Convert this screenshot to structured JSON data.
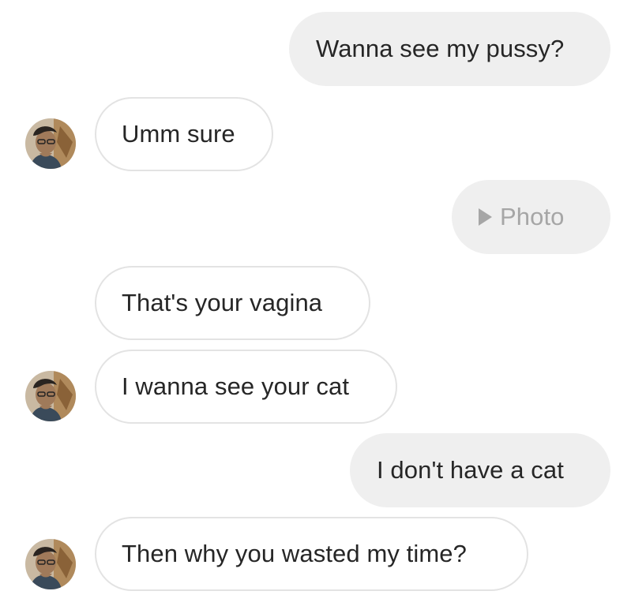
{
  "messages": [
    {
      "direction": "outgoing",
      "text": "Wanna see my pussy?"
    },
    {
      "direction": "incoming",
      "text": "Umm sure",
      "avatar": true
    },
    {
      "direction": "outgoing",
      "type": "photo",
      "text": "Photo",
      "icon": "play-icon"
    },
    {
      "direction": "incoming",
      "text": "That's your vagina",
      "avatar": false
    },
    {
      "direction": "incoming",
      "text": "I wanna see your cat",
      "avatar": true
    },
    {
      "direction": "outgoing",
      "text": "I don't have a cat"
    },
    {
      "direction": "incoming",
      "text": "Then why you wasted my time?",
      "avatar": true
    }
  ],
  "colors": {
    "outgoing_bubble": "#efefef",
    "incoming_border": "#e3e3e3",
    "text": "#262626",
    "photo_label": "#a6a6a6"
  }
}
